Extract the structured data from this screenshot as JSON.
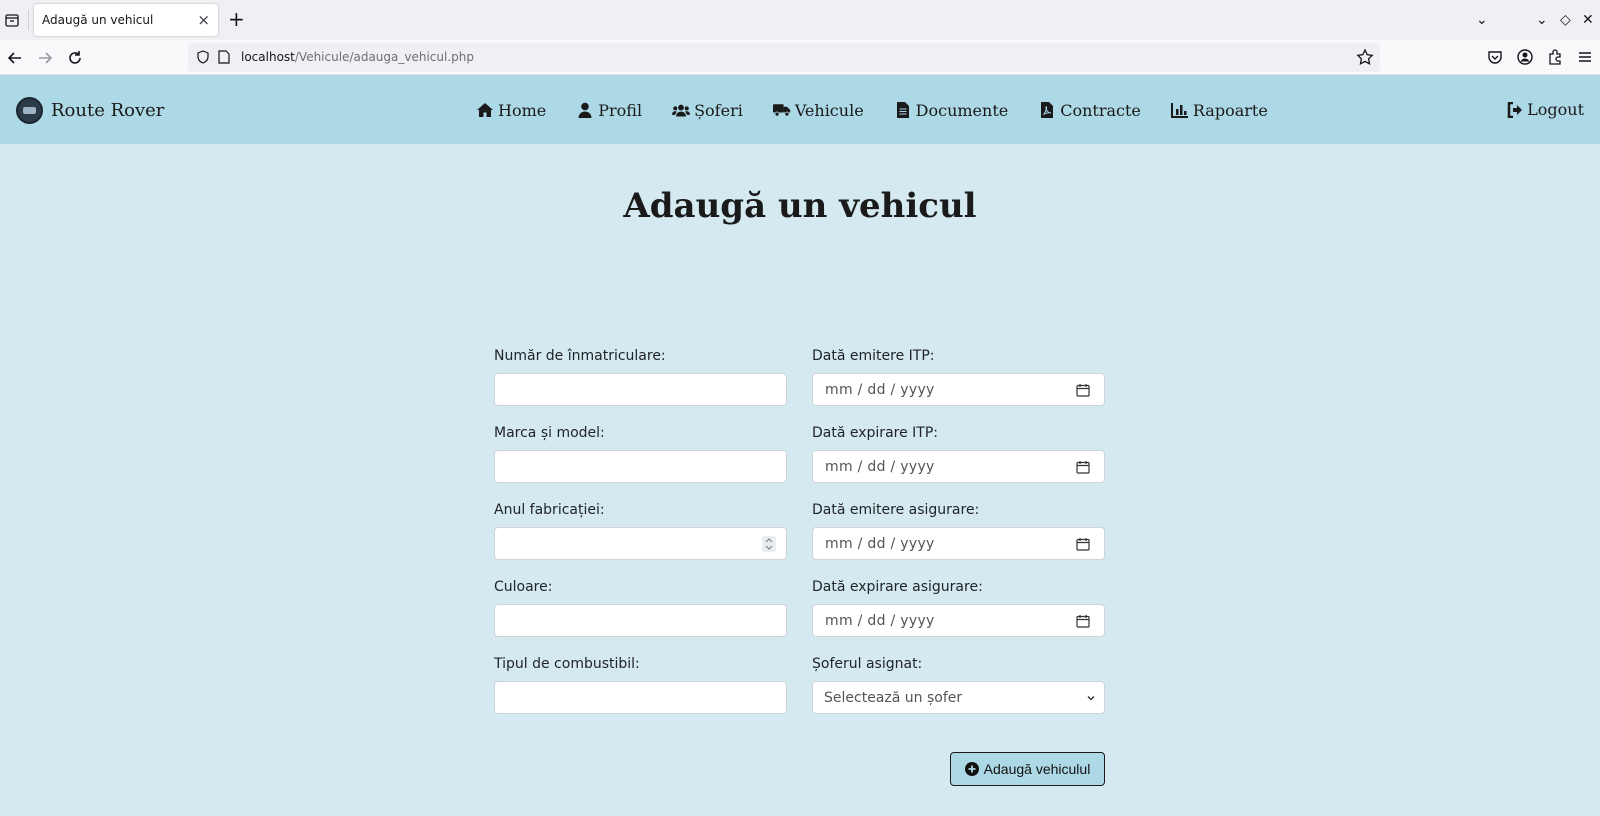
{
  "browser": {
    "tab_title": "Adaugă un vehicul",
    "tab_close": "×",
    "new_tab": "+",
    "url_host": "localhost",
    "url_path": "/Vehicule/adauga_vehicul.php",
    "controls": [
      "⌄",
      "⌄",
      "◇",
      "✕"
    ]
  },
  "header": {
    "brand": "Route Rover",
    "menu": [
      {
        "label": "Home",
        "icon": "home-icon"
      },
      {
        "label": "Profil",
        "icon": "user-icon"
      },
      {
        "label": "Șoferi",
        "icon": "users-icon"
      },
      {
        "label": "Vehicule",
        "icon": "truck-icon"
      },
      {
        "label": "Documente",
        "icon": "document-icon"
      },
      {
        "label": "Contracte",
        "icon": "pdf-file-icon"
      },
      {
        "label": "Rapoarte",
        "icon": "chart-icon"
      }
    ],
    "logout": "Logout"
  },
  "page": {
    "title": "Adaugă un vehicul"
  },
  "form": {
    "left": [
      {
        "label": "Număr de înmatriculare:",
        "type": "text",
        "value": ""
      },
      {
        "label": "Marca și model:",
        "type": "text",
        "value": ""
      },
      {
        "label": "Anul fabricației:",
        "type": "number",
        "value": ""
      },
      {
        "label": "Culoare:",
        "type": "text",
        "value": ""
      },
      {
        "label": "Tipul de combustibil:",
        "type": "text",
        "value": ""
      }
    ],
    "right": [
      {
        "label": "Dată emitere ITP:",
        "type": "date",
        "placeholder": "mm / dd / yyyy"
      },
      {
        "label": "Dată expirare ITP:",
        "type": "date",
        "placeholder": "mm / dd / yyyy"
      },
      {
        "label": "Dată emitere asigurare:",
        "type": "date",
        "placeholder": "mm / dd / yyyy"
      },
      {
        "label": "Dată expirare asigurare:",
        "type": "date",
        "placeholder": "mm / dd / yyyy"
      },
      {
        "label": "Șoferul asignat:",
        "type": "select",
        "selected": "Selectează un șofer"
      }
    ],
    "submit_label": "Adaugă vehiculul"
  },
  "colors": {
    "header_bg": "#add8e6",
    "page_bg": "#d4e9f0",
    "button_bg": "#add8e6"
  }
}
